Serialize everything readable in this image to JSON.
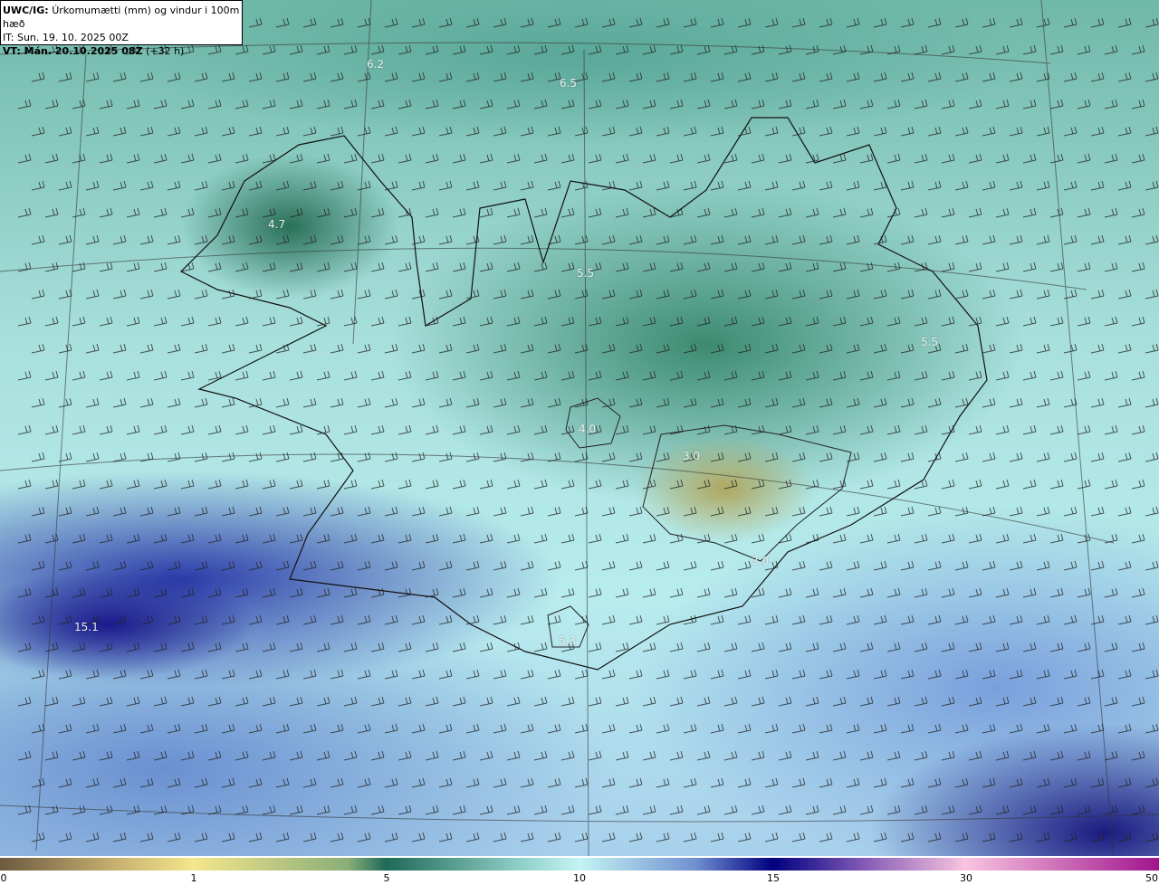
{
  "header": {
    "model": "UWC/IG:",
    "title": "Úrkomumætti (mm) og vindur i 100m hæð",
    "init_time": "IT: Sun. 19. 10. 2025 00Z",
    "valid_prefix": "VT: Mán. 20.10.2025 08Z",
    "lead": "(+32 h)"
  },
  "map_labels": [
    "6.2",
    "6.5",
    "4.7",
    "5.5",
    "4.0",
    "3.0",
    "3.0",
    "5.3",
    "15.1",
    "5.5"
  ],
  "colorbar": {
    "unit": "mm",
    "ticks": [
      "0",
      "1",
      "5",
      "10",
      "15",
      "30",
      "50"
    ],
    "colors": [
      "#6b5a40",
      "#f4e68c",
      "#1f6a58",
      "#c4f4f4",
      "#000080",
      "#f8c4e0",
      "#a0148c"
    ]
  }
}
